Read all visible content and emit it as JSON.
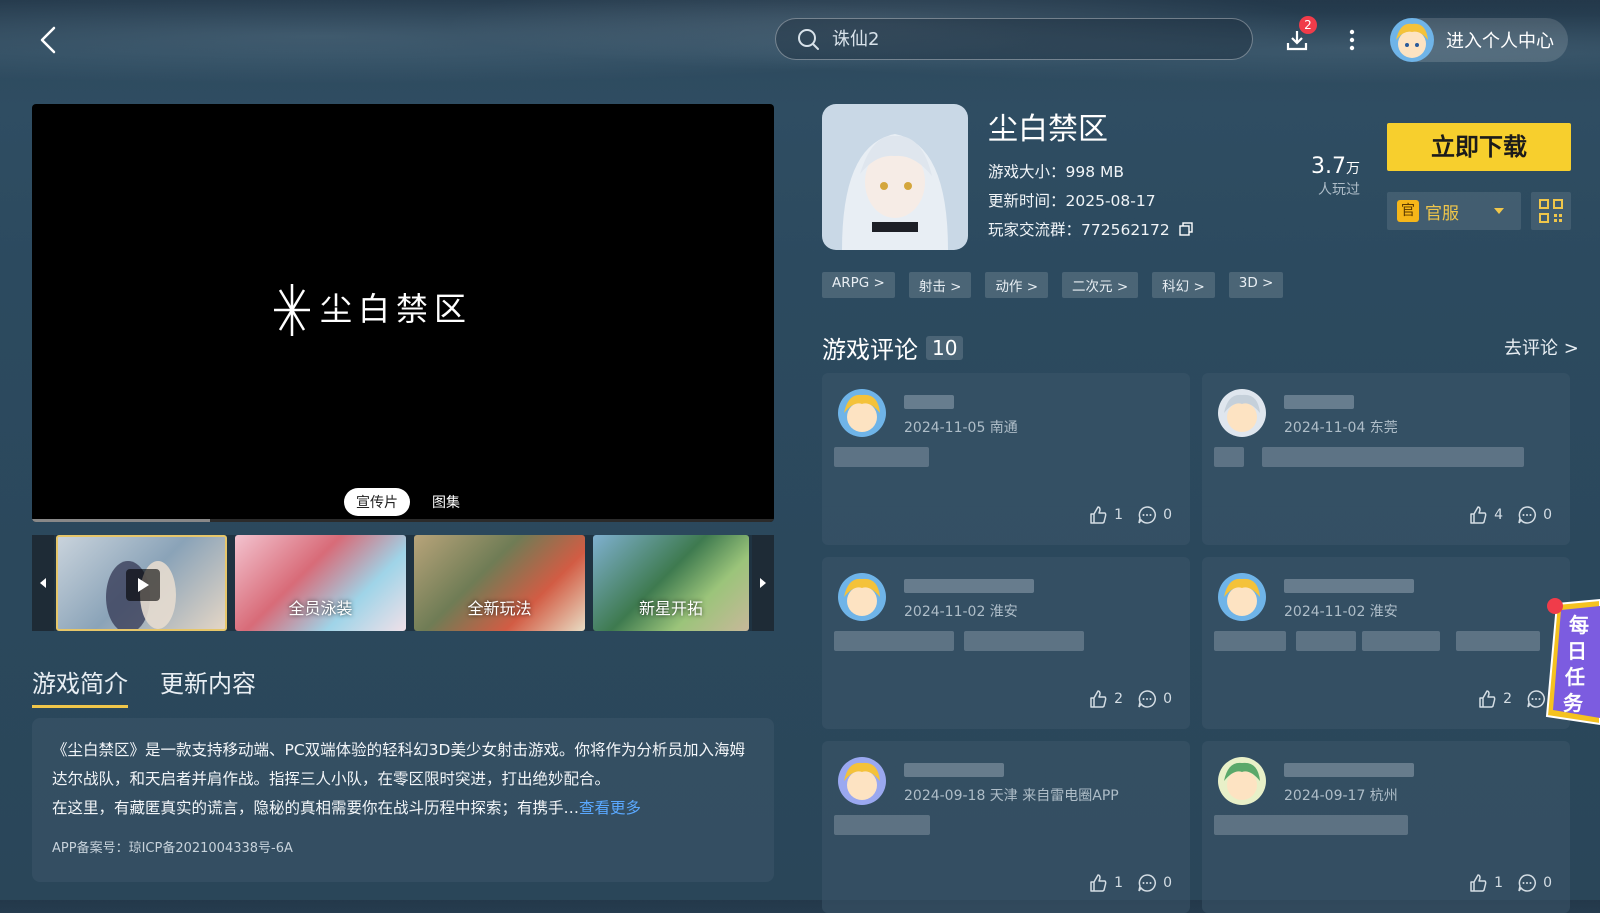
{
  "header": {
    "search_placeholder": "诛仙2",
    "download_badge": "2",
    "profile_label": "进入个人中心"
  },
  "media": {
    "video_logo": "尘白禁区",
    "tabs": [
      "宣传片",
      "图集"
    ],
    "progress": 0.24,
    "thumbnails": [
      {
        "caption": ""
      },
      {
        "caption": "全员泳装"
      },
      {
        "caption": "全新玩法"
      },
      {
        "caption": "新星开拓"
      }
    ]
  },
  "sections": {
    "tabs": [
      "游戏简介",
      "更新内容"
    ],
    "intro": "《尘白禁区》是一款支持移动端、PC双端体验的轻科幻3D美少女射击游戏。你将作为分析员加入海姆达尔战队，和天启者并肩作战。指挥三人小队，在零区限时突进，打出绝妙配合。",
    "intro2": "在这里，有藏匿真实的谎言，隐秘的真相需要你在战斗历程中探索；有携手…",
    "more_label": "查看更多",
    "icp": "APP备案号：琼ICP备2021004338号-6A"
  },
  "game": {
    "name": "尘白禁区",
    "size_label": "游戏大小：",
    "size": "998 MB",
    "update_label": "更新时间：",
    "update": "2025-08-17",
    "group_label": "玩家交流群：",
    "group": "772562172",
    "plays_num": "3.7",
    "plays_unit": "万",
    "plays_label": "人玩过",
    "download_label": "立即下载",
    "server_badge": "官",
    "server_label": "官服",
    "tags": [
      "ARPG >",
      "射击 >",
      "动作 >",
      "二次元 >",
      "科幻 >",
      "3D >"
    ]
  },
  "reviews": {
    "title": "游戏评论",
    "count": "10",
    "go_label": "去评论 >",
    "items": [
      {
        "meta": "2024-11-05 南通",
        "likes": "1",
        "comments": "0"
      },
      {
        "meta": "2024-11-04 东莞",
        "likes": "4",
        "comments": "0"
      },
      {
        "meta": "2024-11-02 淮安",
        "likes": "2",
        "comments": "0"
      },
      {
        "meta": "2024-11-02 淮安",
        "likes": "2",
        "comments": ""
      },
      {
        "meta": "2024-09-18 天津 来自雷电圈APP",
        "likes": "1",
        "comments": "0"
      },
      {
        "meta": "2024-09-17 杭州",
        "likes": "1",
        "comments": "0"
      }
    ]
  },
  "daily_task": "每日任务",
  "colors": {
    "accent": "#f7cf2d",
    "link": "#5aa8ff",
    "badge": "#f03c4a"
  }
}
